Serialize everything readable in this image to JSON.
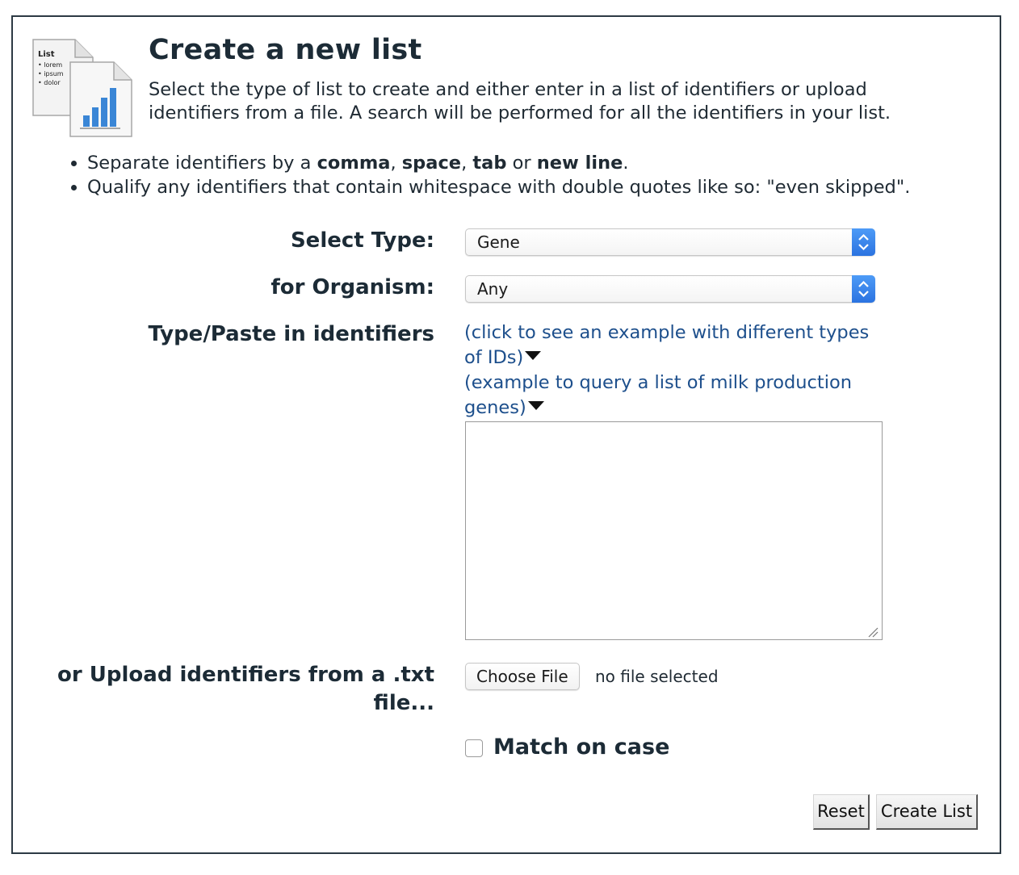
{
  "header": {
    "title": "Create a new list",
    "intro": "Select the type of list to create and either enter in a list of identifiers or upload identifiers from a file. A search will be performed for all the identifiers in your list.",
    "icon": "list-document-icon"
  },
  "hints": {
    "h1_pre": "Separate identifiers by a ",
    "h1_b1": "comma",
    "h1_s1": ", ",
    "h1_b2": "space",
    "h1_s2": ", ",
    "h1_b3": "tab",
    "h1_s3": " or ",
    "h1_b4": "new line",
    "h1_end": ".",
    "h2": "Qualify any identifiers that contain whitespace with double quotes like so: \"even skipped\"."
  },
  "form": {
    "type_label": "Select Type:",
    "type_value": "Gene",
    "organism_label": "for Organism:",
    "organism_value": "Any",
    "paste_label": "Type/Paste in identifiers",
    "example1": "(click to see an example with different types of IDs)",
    "example2": "(example to query a list of milk production genes)",
    "textarea_value": "",
    "upload_label": "or Upload identifiers from a .txt file...",
    "choose_file": "Choose File",
    "no_file": "no file selected",
    "match_case": "Match on case",
    "match_case_checked": false,
    "reset": "Reset",
    "create": "Create List"
  },
  "colors": {
    "link": "#1d4f8c",
    "select_accent": "#2b73e0",
    "border": "#2d3a44"
  }
}
